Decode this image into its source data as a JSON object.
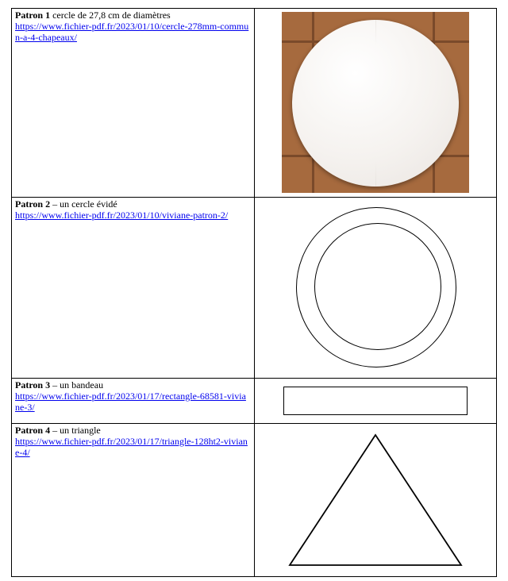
{
  "patterns": [
    {
      "name_label": "Patron 1",
      "desc": "  cercle de 27,8 cm de diamètres",
      "link": "https://www.fichier-pdf.fr/2023/01/10/cercle-278mm-commun-a-4-chapeaux/"
    },
    {
      "name_label": "Patron 2",
      "desc": " – un cercle évidé",
      "link": "https://www.fichier-pdf.fr/2023/01/10/viviane-patron-2/"
    },
    {
      "name_label": "Patron 3",
      "desc": " – un bandeau",
      "link": "https://www.fichier-pdf.fr/2023/01/17/rectangle-68581-viviane-3/"
    },
    {
      "name_label": "Patron 4",
      "desc": " – un triangle",
      "link": "https://www.fichier-pdf.fr/2023/01/17/triangle-128ht2-viviane-4/"
    }
  ]
}
